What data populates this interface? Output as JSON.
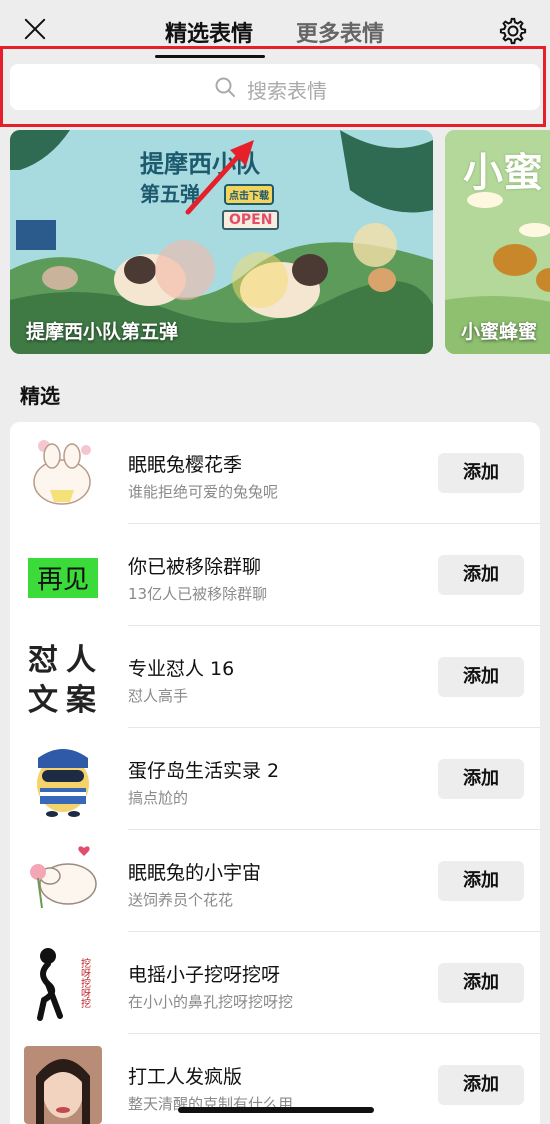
{
  "header": {
    "tabs": [
      {
        "label": "精选表情",
        "selected": true
      },
      {
        "label": "更多表情",
        "selected": false
      }
    ]
  },
  "search": {
    "placeholder": "搜索表情"
  },
  "banners": [
    {
      "caption": "提摩西小队第五弹",
      "art_title": "提摩西小队",
      "art_subtitle": "第五弹",
      "art_tag": "点击下载",
      "art_sign": "OPEN"
    },
    {
      "caption": "小蜜蜂蜜",
      "art_title": "小蜜"
    }
  ],
  "section": {
    "title": "精选"
  },
  "items": [
    {
      "name": "眠眠兔樱花季",
      "desc": "谁能拒绝可爱的兔兔呢",
      "action": "添加"
    },
    {
      "name": "你已被移除群聊",
      "desc": "13亿人已被移除群聊",
      "action": "添加",
      "thumb_text": "再见"
    },
    {
      "name": "专业怼人 16",
      "desc": "怼人高手",
      "action": "添加",
      "thumb_text": [
        "怼",
        "人",
        "文",
        "案"
      ]
    },
    {
      "name": "蛋仔岛生活实录 2",
      "desc": "搞点尬的",
      "action": "添加"
    },
    {
      "name": "眠眠兔的小宇宙",
      "desc": "送饲养员个花花",
      "action": "添加"
    },
    {
      "name": "电摇小子挖呀挖呀",
      "desc": "在小小的鼻孔挖呀挖呀挖",
      "action": "添加",
      "thumb_text": "挖呀挖呀挖"
    },
    {
      "name": "打工人发疯版",
      "desc": "整天清醒的克制有什么用",
      "action": "添加"
    }
  ],
  "colors": {
    "highlight": "#e5202a",
    "background": "#ededed"
  }
}
